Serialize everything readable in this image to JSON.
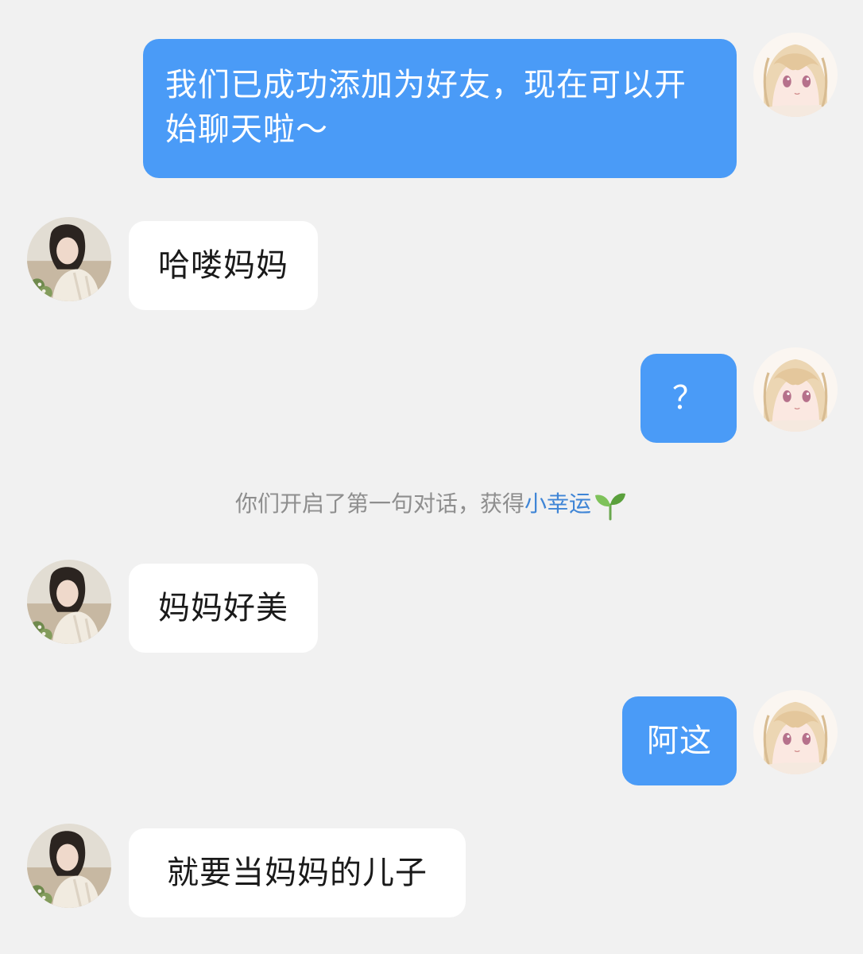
{
  "messages": [
    {
      "from": "me",
      "text": "我们已成功添加为好友，现在可以开始聊天啦～"
    },
    {
      "from": "contact",
      "text": "哈喽妈妈"
    },
    {
      "from": "me",
      "text": "？"
    },
    {
      "from": "contact",
      "text": "妈妈好美"
    },
    {
      "from": "me",
      "text": "阿这"
    },
    {
      "from": "contact",
      "text": "就要当妈妈的儿子"
    }
  ],
  "system_notice": {
    "text": "你们开启了第一句对话，获得",
    "highlight": "小幸运",
    "icon": "sprout-icon"
  },
  "colors": {
    "background": "#f1f1f1",
    "sent_bubble": "#4a9bf7",
    "received_bubble": "#ffffff",
    "highlight": "#3f85d6"
  },
  "avatars": {
    "me": "anime-girl-avatar",
    "contact": "woman-photo-avatar"
  }
}
